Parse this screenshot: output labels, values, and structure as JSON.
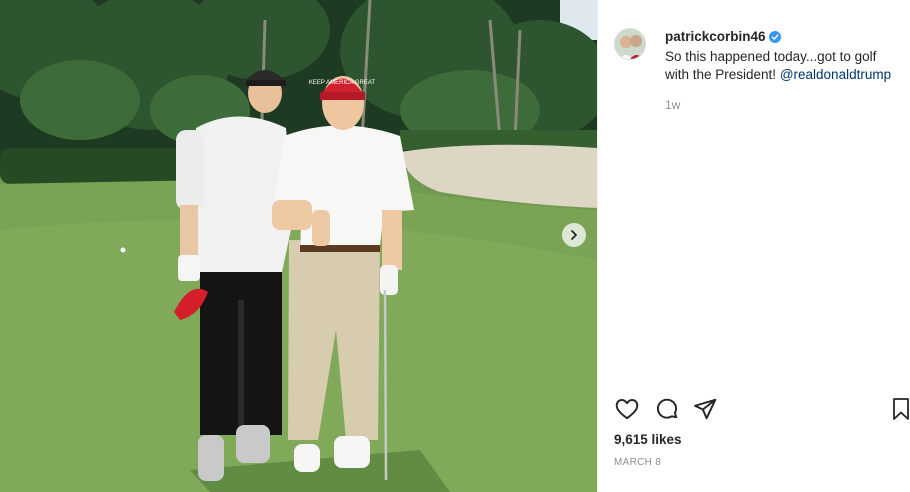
{
  "post": {
    "username": "patrickcorbin46",
    "verified": true,
    "caption_text": "So this happened today...got to golf with the President!",
    "mention": "@realdonaldtrump",
    "time_ago": "1w",
    "likes": "9,615 likes",
    "date": "MARCH 8",
    "hat_text": "KEEP AMERICA GREAT"
  },
  "icons": {
    "like": "heart-icon",
    "comment": "comment-icon",
    "share": "paper-plane-icon",
    "save": "bookmark-icon",
    "verified": "verified-badge-icon",
    "next": "chevron-right-icon"
  },
  "colors": {
    "verified_blue": "#3897f0",
    "mention": "#00376b",
    "secondary_text": "#8e8e8e"
  }
}
